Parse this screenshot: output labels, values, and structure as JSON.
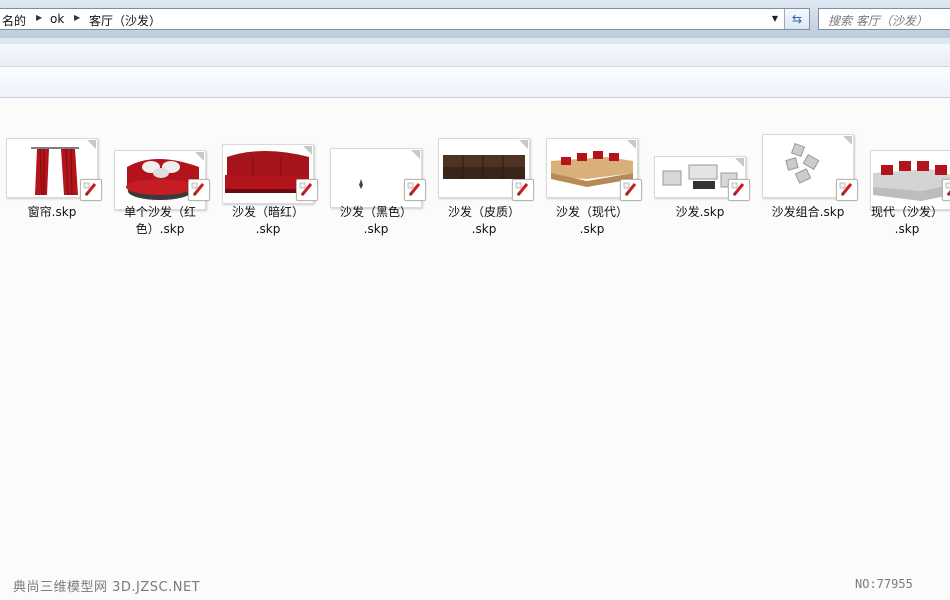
{
  "address_bar": {
    "crumbs": [
      "名的",
      "ok",
      "客厅（沙发）"
    ],
    "dropdown_icon": "chevron-down-icon",
    "refresh_icon": "refresh-icon"
  },
  "search": {
    "placeholder": "搜索 客厅（沙发）"
  },
  "files": [
    {
      "line1": "窗帘.skp",
      "line2": ""
    },
    {
      "line1": "单个沙发（红",
      "line2": "色）.skp"
    },
    {
      "line1": "沙发（暗红）",
      "line2": ".skp"
    },
    {
      "line1": "沙发（黑色）",
      "line2": ".skp"
    },
    {
      "line1": "沙发（皮质）",
      "line2": ".skp"
    },
    {
      "line1": "沙发（现代）",
      "line2": ".skp"
    },
    {
      "line1": "沙发.skp",
      "line2": ""
    },
    {
      "line1": "沙发组合.skp",
      "line2": ""
    },
    {
      "line1": "现代（沙发）",
      "line2": ".skp"
    }
  ],
  "watermark": {
    "left": "典尚三维模型网 3D.JZSC.NET",
    "right": "NO:77955"
  },
  "colors": {
    "sofa_red": "#b3141b",
    "accent_blue": "#2a5fa8"
  }
}
